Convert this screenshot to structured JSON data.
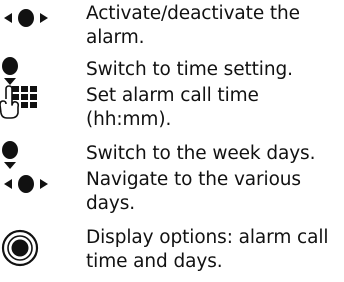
{
  "instructions": [
    {
      "icon": "navigate-left-right-icon",
      "text": "Activate/deactivate the\nalarm."
    },
    {
      "icon": "navigate-down-icon",
      "text": "Switch to time setting."
    },
    {
      "icon": "keypad-entry-icon",
      "text": "Set alarm call time\n(hh:mm)."
    },
    {
      "icon": "navigate-down-icon",
      "text": "Switch to the week days."
    },
    {
      "icon": "navigate-left-right-icon",
      "text": "Navigate to the various\ndays."
    },
    {
      "icon": "center-select-icon",
      "text": "Display options: alarm call\ntime and days."
    }
  ]
}
